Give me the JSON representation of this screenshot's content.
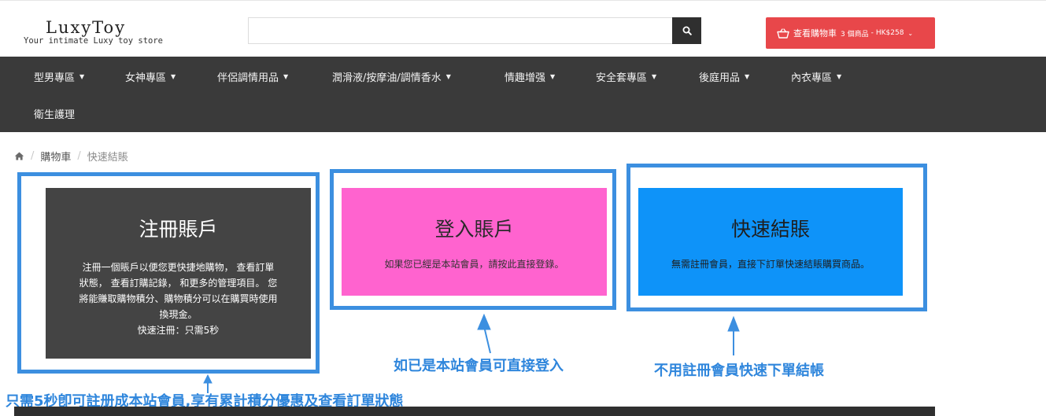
{
  "header": {
    "logo": {
      "title": "LuxyToy",
      "tagline": "Your intimate Luxy toy store"
    },
    "search": {
      "placeholder": "",
      "button_icon": "search-icon"
    },
    "cart": {
      "icon": "basket-icon",
      "label": "查看購物車",
      "count": "3 個商品",
      "separator": "-",
      "total": "HK$258",
      "caret": "chevron-down-icon",
      "color": "#e8474a"
    }
  },
  "nav": {
    "color": "#3a3a3a",
    "items": [
      {
        "label": "型男專區",
        "dropdown": true
      },
      {
        "label": "女神專區",
        "dropdown": true
      },
      {
        "label": "伴侶調情用品",
        "dropdown": true
      },
      {
        "label": "潤滑液/按摩油/調情香水",
        "dropdown": true
      },
      {
        "label": "情趣增强",
        "dropdown": true
      },
      {
        "label": "安全套專區",
        "dropdown": true
      },
      {
        "label": "後庭用品",
        "dropdown": true
      },
      {
        "label": "內衣專區",
        "dropdown": true
      },
      {
        "label": "衛生護理",
        "dropdown": false
      }
    ]
  },
  "breadcrumb": {
    "home_icon": "home-icon",
    "items": [
      "購物車",
      "快速結賬"
    ]
  },
  "cards": {
    "register": {
      "title": "注冊賬戶",
      "desc_lines": [
        "注冊一個賬戶以便您更快捷地購物， 查看訂單",
        "狀態， 查看訂購記錄， 和更多的管理項目。 您",
        "將能賺取購物積分、購物積分可以在購買時使用",
        "換現金。"
      ],
      "note": "快速注冊：只需5秒",
      "color": "#444444"
    },
    "login": {
      "title": "登入賬戶",
      "desc": "如果您已經是本站會員，請按此直接登錄。",
      "color": "#ff63cf"
    },
    "guest": {
      "title": "快速結賬",
      "desc": "無需註冊會員，直接下訂單快速結賬購買商品。",
      "color": "#0e93f9"
    }
  },
  "annotations": {
    "color": "#2f86dc",
    "login": "如已是本站會員可直接登入",
    "guest": "不用註冊會員快速下單結帳",
    "register": "只需5秒卽可註册成本站會員,享有累計積分優惠及查看訂單狀態"
  }
}
